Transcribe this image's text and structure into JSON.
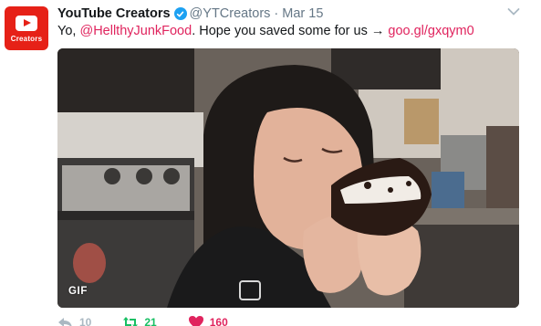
{
  "tweet": {
    "author_name": "YouTube Creators",
    "avatar_text": "Creators",
    "handle": "@YTCreators",
    "separator": "·",
    "date": "Mar 15",
    "text_prefix": "Yo, ",
    "mention": "@HellthyJunkFood",
    "text_middle": ". Hope you saved some for us → ",
    "link": "goo.gl/gxqym0",
    "media_badge": "GIF",
    "verified": true
  },
  "actions": {
    "reply_count": "10",
    "retweet_count": "21",
    "like_count": "160"
  },
  "colors": {
    "brand_red": "#e62117",
    "link_pink": "#e0245e",
    "verified_blue": "#1da1f2",
    "retweet_green": "#17bf63",
    "muted_gray": "#657786"
  },
  "icons": [
    "play-icon",
    "verified-icon",
    "caret-down-icon",
    "reply-icon",
    "retweet-icon",
    "heart-icon"
  ]
}
